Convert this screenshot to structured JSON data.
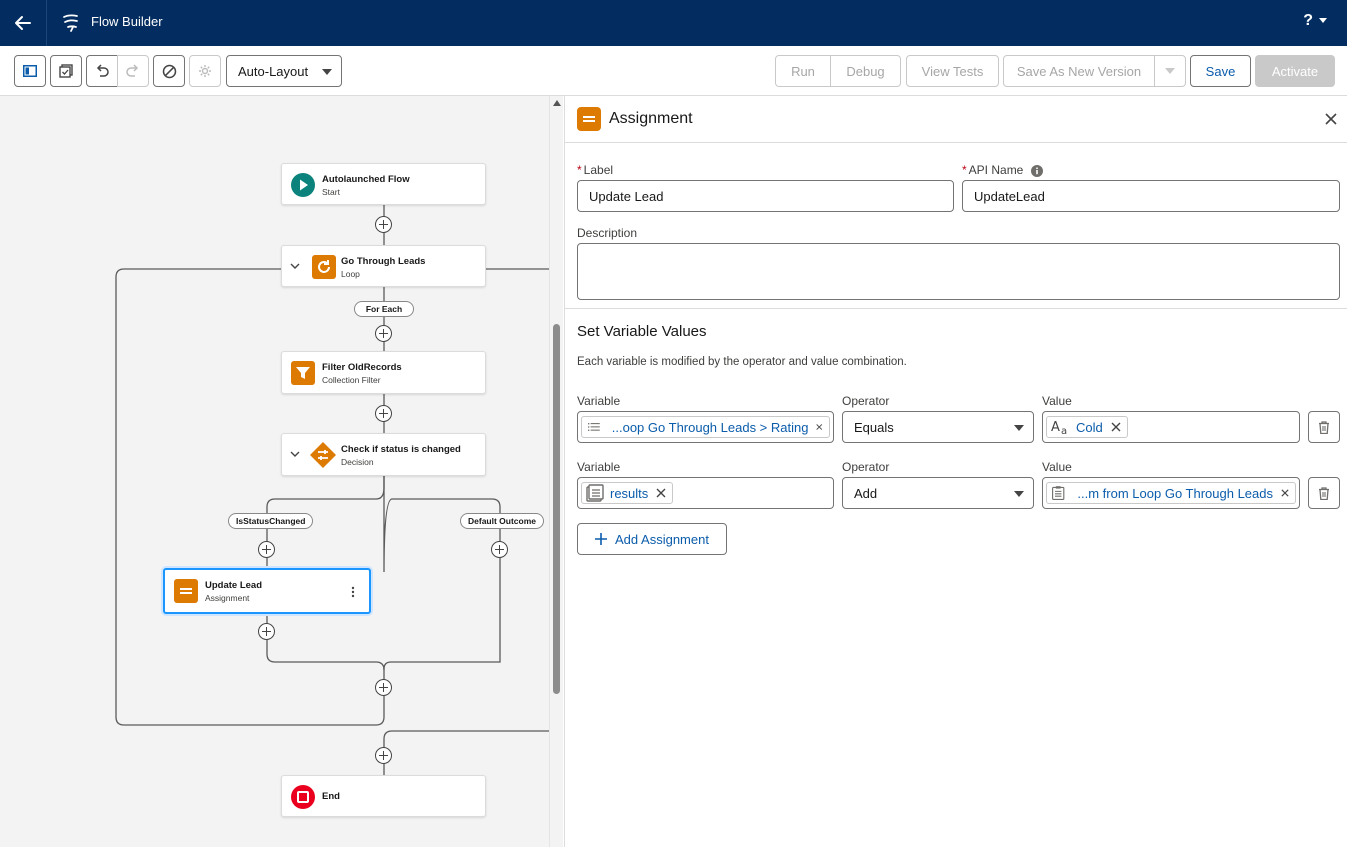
{
  "header": {
    "title": "Flow Builder",
    "help_label": "?",
    "brand_color": "#032d60"
  },
  "toolbar": {
    "layout_select": "Auto-Layout",
    "run_label": "Run",
    "debug_label": "Debug",
    "view_tests_label": "View Tests",
    "save_as_new_version_label": "Save As New Version",
    "save_label": "Save",
    "activate_label": "Activate"
  },
  "canvas": {
    "nodes": {
      "start": {
        "title": "Autolaunched Flow",
        "subtitle": "Start",
        "icon": "play-icon",
        "color": "#0b827c"
      },
      "loop": {
        "title": "Go Through Leads",
        "subtitle": "Loop",
        "icon": "loop-icon",
        "color": "#dd7a01"
      },
      "filter": {
        "title": "Filter OldRecords",
        "subtitle": "Collection Filter",
        "icon": "filter-icon",
        "color": "#dd7a01"
      },
      "decision": {
        "title": "Check if status is changed",
        "subtitle": "Decision",
        "icon": "decision-icon",
        "color": "#dd7a01"
      },
      "assignment": {
        "title": "Update Lead",
        "subtitle": "Assignment",
        "icon": "assignment-icon",
        "color": "#dd7a01"
      },
      "end": {
        "title": "End",
        "icon": "stop-icon",
        "color": "#ea001e"
      }
    },
    "labels": {
      "for_each": "For Each",
      "branch_1": "IsStatusChanged",
      "branch_2": "Default Outcome"
    }
  },
  "panel": {
    "title": "Assignment",
    "label_field": {
      "label": "Label",
      "value": "Update Lead"
    },
    "api_name_field": {
      "label": "API Name",
      "value": "UpdateLead"
    },
    "description_field": {
      "label": "Description",
      "value": ""
    },
    "section_title": "Set Variable Values",
    "section_desc": "Each variable is modified by the operator and value combination.",
    "column_labels": {
      "variable": "Variable",
      "operator": "Operator",
      "value": "Value"
    },
    "rows": [
      {
        "variable": "...oop Go Through Leads > Rating",
        "operator": "Equals",
        "value": "Cold"
      },
      {
        "variable": "results",
        "operator": "Add",
        "value": "...m from Loop Go Through Leads"
      }
    ],
    "add_assignment_label": "Add Assignment"
  }
}
